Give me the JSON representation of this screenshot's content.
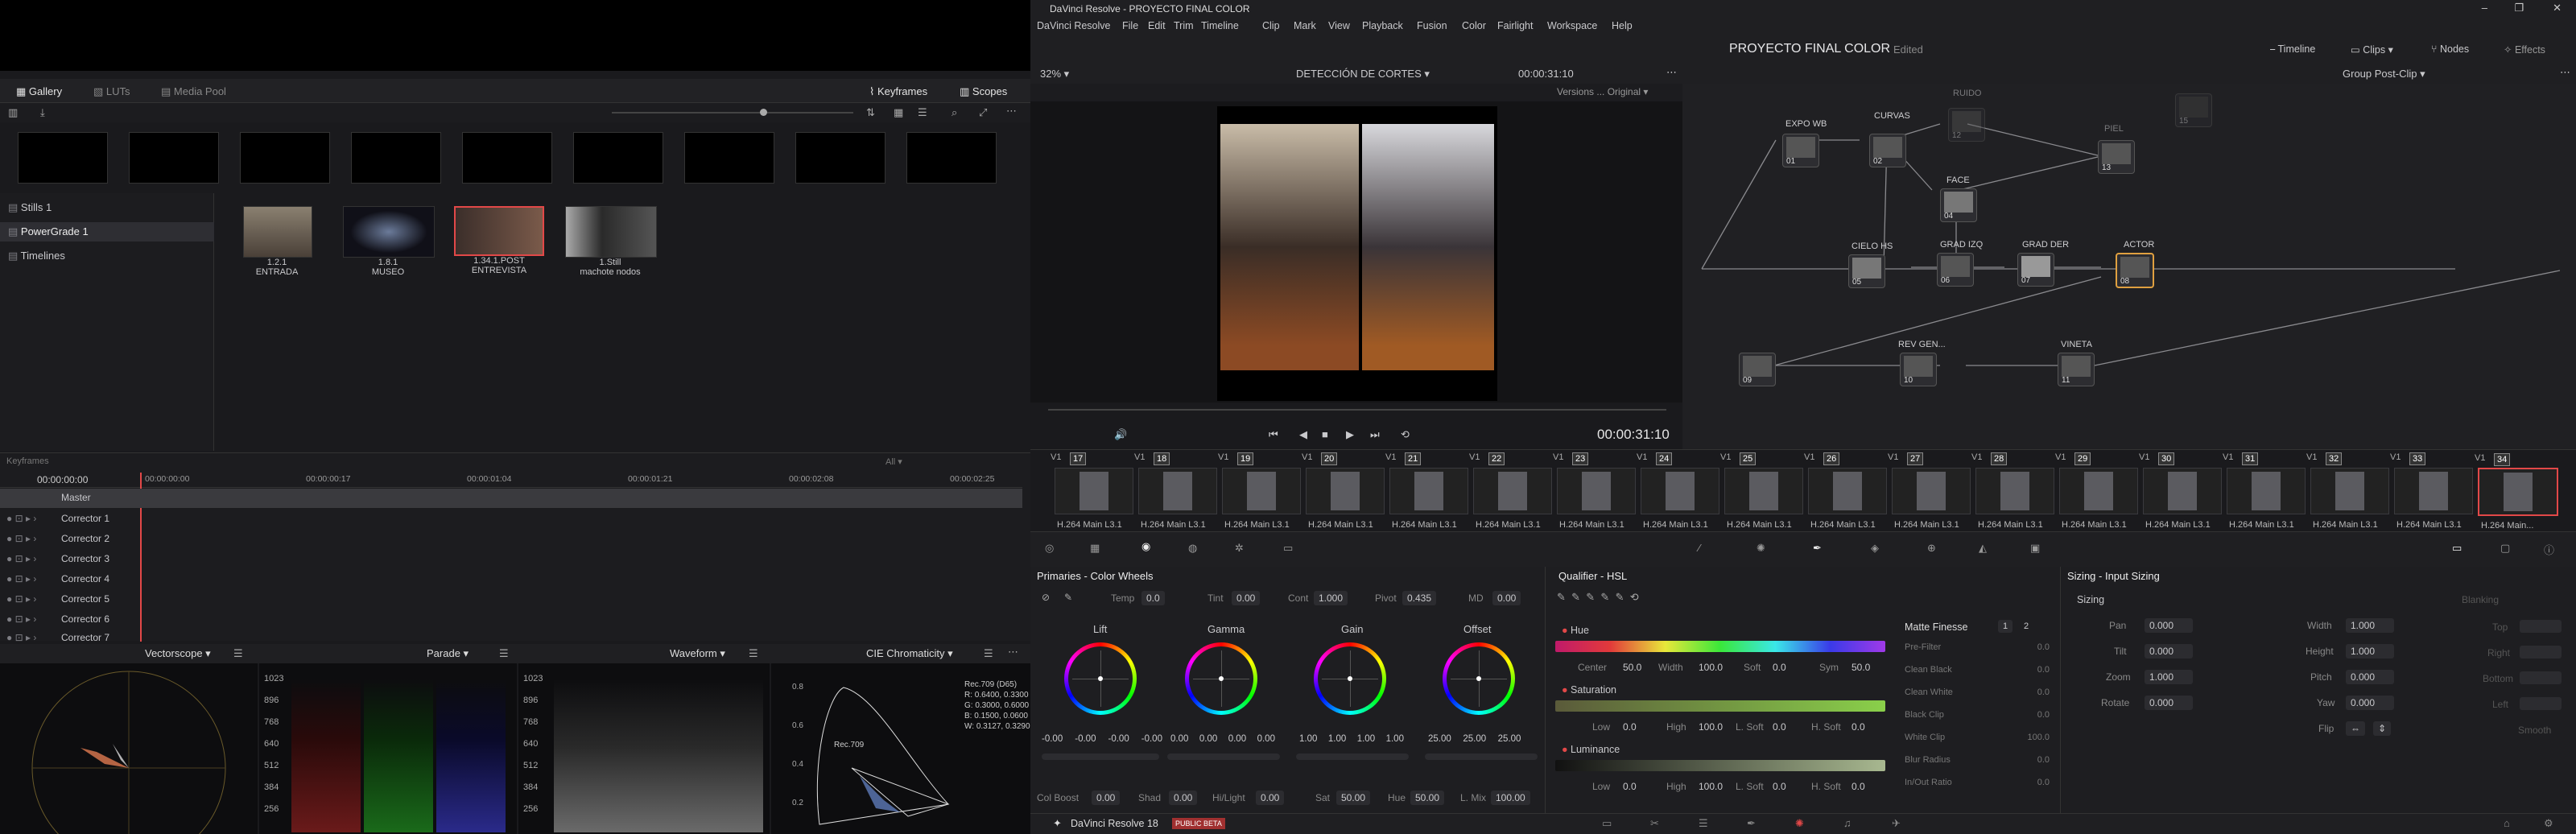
{
  "window": {
    "title": "DaVinci Resolve - PROYECTO FINAL COLOR"
  },
  "menu": [
    "DaVinci Resolve",
    "File",
    "Edit",
    "Trim",
    "Timeline",
    "Clip",
    "Mark",
    "View",
    "Playback",
    "Fusion",
    "Color",
    "Fairlight",
    "Workspace",
    "Help"
  ],
  "header": {
    "project": "PROYECTO FINAL COLOR",
    "status": "Edited",
    "right_tabs": [
      "Timeline",
      "Clips",
      "Nodes",
      "Effects"
    ]
  },
  "gallery": {
    "tabs": [
      "Gallery",
      "LUTs",
      "Media Pool"
    ],
    "right_tabs": [
      "Keyframes",
      "Scopes"
    ],
    "albums": [
      "Stills 1",
      "PowerGrade 1",
      "Timelines"
    ],
    "stills": [
      {
        "id": "1.2.1",
        "name": "ENTRADA"
      },
      {
        "id": "1.8.1",
        "name": "MUSEO"
      },
      {
        "id": "1.34.1.POST",
        "name": "ENTREVISTA"
      },
      {
        "id": "1.Still",
        "name": "machote nodos"
      }
    ]
  },
  "viewer": {
    "zoom": "32%",
    "timeline_name": "DETECCIÓN DE CORTES",
    "timecode_top": "00:00:31:10",
    "versions": "Versions ... Original",
    "timecode": "00:00:31:10"
  },
  "nodes": {
    "mode": "Group Post-Clip",
    "items": [
      {
        "name": "EXPO WB",
        "num": "01"
      },
      {
        "name": "CURVAS",
        "num": "02"
      },
      {
        "name": "RUIDO",
        "num": "12"
      },
      {
        "name": "PIEL",
        "num": "13"
      },
      {
        "name": "FACE",
        "num": "04"
      },
      {
        "name": "CIELO HS",
        "num": "05"
      },
      {
        "name": "GRAD IZQ",
        "num": "06"
      },
      {
        "name": "GRAD DER",
        "num": "07"
      },
      {
        "name": "ACTOR",
        "num": "08"
      },
      {
        "name": "",
        "num": "09"
      },
      {
        "name": "REV GEN...",
        "num": "10"
      },
      {
        "name": "VINETA",
        "num": "11"
      },
      {
        "name": "",
        "num": "15"
      }
    ]
  },
  "keyframes": {
    "title": "Keyframes",
    "filter": "All",
    "timecodes": [
      "00:00:00:00",
      "00:00:00:00",
      "00:00:00:17",
      "00:00:01:04",
      "00:00:01:21",
      "00:00:02:08",
      "00:00:02:25"
    ],
    "tracks": [
      "Master",
      "Corrector 1",
      "Corrector 2",
      "Corrector 3",
      "Corrector 4",
      "Corrector 5",
      "Corrector 6",
      "Corrector 7"
    ]
  },
  "clips": {
    "numbers": [
      "17",
      "18",
      "19",
      "20",
      "21",
      "22",
      "23",
      "24",
      "25",
      "26",
      "27",
      "28",
      "29",
      "30",
      "31",
      "32",
      "33",
      "34"
    ],
    "track_label": "V1",
    "codec": "H.264 Main L3.1",
    "codec_active": "H.264 Main..."
  },
  "scopes": {
    "panels": [
      "Vectorscope",
      "Parade",
      "Waveform",
      "CIE Chromaticity"
    ],
    "scale": [
      "1023",
      "896",
      "768",
      "640",
      "512",
      "384",
      "256"
    ],
    "cie": {
      "gamut": "Rec.709 (D65)",
      "r": "R: 0.6400, 0.3300",
      "g": "G: 0.3000, 0.6000",
      "b": "B: 0.1500, 0.0600",
      "w": "W: 0.3127, 0.3290",
      "label": "Rec.709",
      "yaxis": [
        "0.8",
        "0.6",
        "0.4",
        "0.2"
      ]
    }
  },
  "primaries": {
    "title": "Primaries - Color Wheels",
    "top": {
      "temp_label": "Temp",
      "temp": "0.0",
      "tint_label": "Tint",
      "tint": "0.00",
      "cont_label": "Cont",
      "cont": "1.000",
      "pivot_label": "Pivot",
      "pivot": "0.435",
      "md_label": "MD",
      "md": "0.00"
    },
    "wheels": [
      {
        "name": "Lift",
        "values": [
          "-0.00",
          "-0.00",
          "-0.00",
          "-0.00"
        ]
      },
      {
        "name": "Gamma",
        "values": [
          "0.00",
          "0.00",
          "0.00",
          "0.00"
        ]
      },
      {
        "name": "Gain",
        "values": [
          "1.00",
          "1.00",
          "1.00",
          "1.00"
        ]
      },
      {
        "name": "Offset",
        "values": [
          "25.00",
          "25.00",
          "25.00",
          ""
        ]
      }
    ],
    "bottom": {
      "colboost_label": "Col Boost",
      "colboost": "0.00",
      "shad_label": "Shad",
      "shad": "0.00",
      "hilight_label": "Hi/Light",
      "hilight": "0.00",
      "sat_label": "Sat",
      "sat": "50.00",
      "hue_label": "Hue",
      "hue": "50.00",
      "lmix_label": "L. Mix",
      "lmix": "100.00"
    }
  },
  "qualifier": {
    "title": "Qualifier - HSL",
    "hue": {
      "label": "Hue",
      "center_label": "Center",
      "center": "50.0",
      "width_label": "Width",
      "width": "100.0",
      "soft_label": "Soft",
      "soft": "0.0",
      "sym_label": "Sym",
      "sym": "50.0"
    },
    "sat": {
      "label": "Saturation",
      "low_label": "Low",
      "low": "0.0",
      "high_label": "High",
      "high": "100.0",
      "lsoft_label": "L. Soft",
      "lsoft": "0.0",
      "hsoft_label": "H. Soft",
      "hsoft": "0.0"
    },
    "lum": {
      "label": "Luminance",
      "low_label": "Low",
      "low": "0.0",
      "high_label": "High",
      "high": "100.0",
      "lsoft_label": "L. Soft",
      "lsoft": "0.0",
      "hsoft_label": "H. Soft",
      "hsoft": "0.0"
    },
    "matte": {
      "title": "Matte Finesse",
      "tabs": [
        "1",
        "2"
      ],
      "rows": [
        [
          "Pre-Filter",
          "0.0"
        ],
        [
          "Clean Black",
          "0.0"
        ],
        [
          "Clean White",
          "0.0"
        ],
        [
          "Black Clip",
          "0.0"
        ],
        [
          "White Clip",
          "100.0"
        ],
        [
          "Blur Radius",
          "0.0"
        ],
        [
          "In/Out Ratio",
          "0.0"
        ]
      ]
    }
  },
  "sizing": {
    "title": "Sizing - Input Sizing",
    "section": "Sizing",
    "left": [
      [
        "Pan",
        "0.000"
      ],
      [
        "Tilt",
        "0.000"
      ],
      [
        "Zoom",
        "1.000"
      ],
      [
        "Rotate",
        "0.000"
      ]
    ],
    "right": [
      [
        "Width",
        "1.000"
      ],
      [
        "Height",
        "1.000"
      ],
      [
        "Pitch",
        "0.000"
      ],
      [
        "Yaw",
        "0.000"
      ],
      [
        "Flip",
        ""
      ]
    ],
    "blanking": {
      "title": "Blanking",
      "rows": [
        "Top",
        "Right",
        "Bottom",
        "Left"
      ],
      "smooth": "Smooth"
    }
  },
  "footer": {
    "app": "DaVinci Resolve 18",
    "badge": "PUBLIC BETA"
  }
}
